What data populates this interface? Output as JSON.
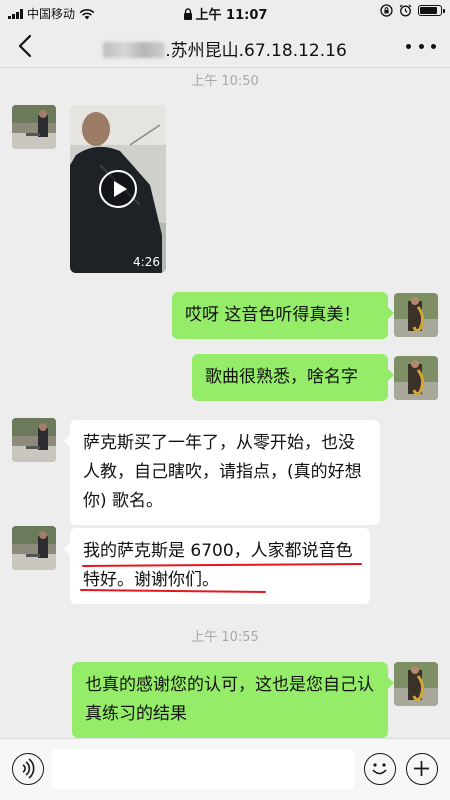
{
  "status_bar": {
    "carrier": "中国移动",
    "time": "上午 11:07"
  },
  "header": {
    "title_suffix": ".苏州昆山.67.18.12.16",
    "back_icon": "chevron-left-icon",
    "more_icon": "more-dots-icon"
  },
  "chat": {
    "time_1": "上午 10:50",
    "video_duration": "4:26",
    "msg_1": "哎呀 这音色听得真美！",
    "msg_2": "歌曲很熟悉，啥名字",
    "msg_3": "萨克斯买了一年了，从零开始，也没人教，自己瞎吹，请指点，(真的好想你) 歌名。",
    "msg_4": "我的萨克斯是 6700，人家都说音色特好。谢谢你们。",
    "time_2": "上午 10:55",
    "msg_5": "也真的感谢您的认可，这也是您自己认真练习的结果"
  },
  "input_bar": {
    "voice_icon": "voice-icon",
    "emoji_icon": "emoji-icon",
    "plus_icon": "plus-icon",
    "input_value": ""
  },
  "colors": {
    "background": "#ededed",
    "bubble_green": "#95ec69",
    "bubble_white": "#ffffff",
    "annotation_red": "#e4171e"
  }
}
